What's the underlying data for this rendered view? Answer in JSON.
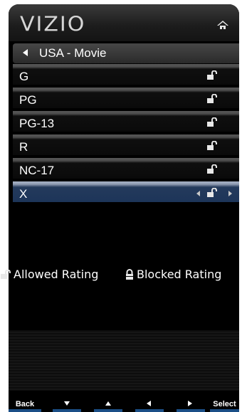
{
  "header": {
    "logo": "VIZIO",
    "home_icon": "home-icon"
  },
  "title_row": {
    "back_icon": "left-arrow-icon",
    "title": "USA - Movie"
  },
  "ratings": [
    {
      "label": "G",
      "status": "allowed",
      "icon": "unlocked-padlock-icon"
    },
    {
      "label": "PG",
      "status": "allowed",
      "icon": "unlocked-padlock-icon"
    },
    {
      "label": "PG-13",
      "status": "allowed",
      "icon": "unlocked-padlock-icon"
    },
    {
      "label": "R",
      "status": "allowed",
      "icon": "unlocked-padlock-icon"
    },
    {
      "label": "NC-17",
      "status": "allowed",
      "icon": "unlocked-padlock-icon"
    },
    {
      "label": "X",
      "status": "allowed",
      "icon": "unlocked-padlock-icon",
      "selected": true
    }
  ],
  "legend": {
    "allowed_label": "Allowed Rating",
    "blocked_label": "Blocked Rating"
  },
  "softkeys": {
    "back": "Back",
    "down_icon": "down-arrow-icon",
    "up_icon": "up-arrow-icon",
    "left_icon": "left-arrow-icon",
    "right_icon": "right-arrow-icon",
    "select": "Select"
  },
  "colors": {
    "background": "#000000",
    "selected_row": "#1d3559",
    "softkey_bar": "#1a4e86",
    "text": "#ffffff"
  }
}
